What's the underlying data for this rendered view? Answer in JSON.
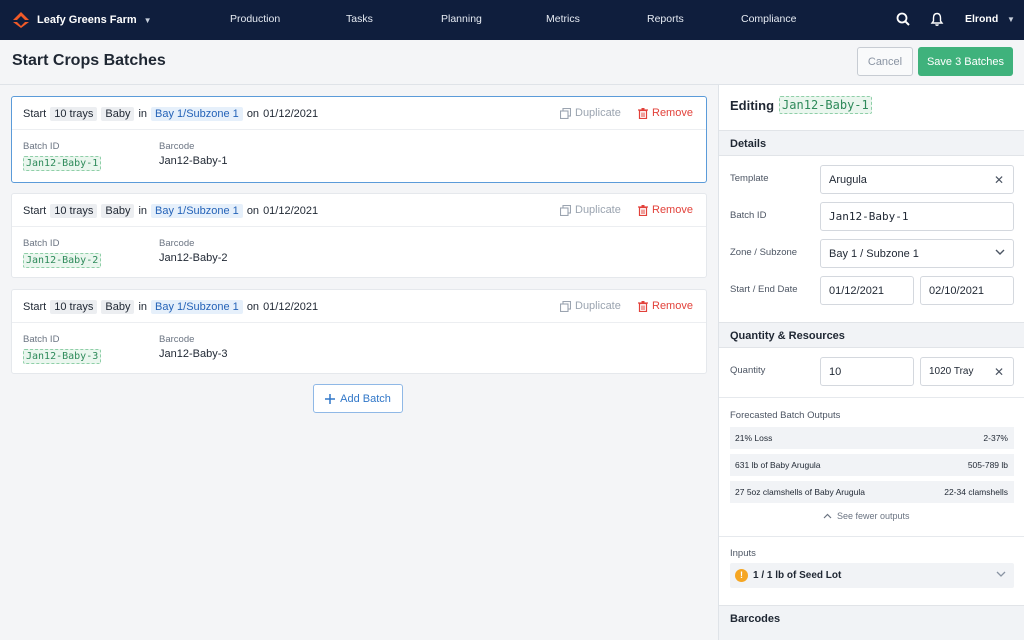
{
  "nav": {
    "brand": "Leafy Greens Farm",
    "items": [
      "Production",
      "Tasks",
      "Planning",
      "Metrics",
      "Reports",
      "Compliance"
    ],
    "user": "Elrond"
  },
  "header": {
    "title": "Start Crops Batches",
    "cancel_label": "Cancel",
    "save_label": "Save 3 Batches"
  },
  "batch_common": {
    "start_word": "Start",
    "qty": "10 trays",
    "crop": "Baby",
    "in_word": "in",
    "location": "Bay 1/Subzone 1",
    "on_word": "on",
    "date": "01/12/2021",
    "duplicate_label": "Duplicate",
    "remove_label": "Remove",
    "batch_id_label": "Batch ID",
    "barcode_label": "Barcode"
  },
  "batches": [
    {
      "batch_id": "Jan12-Baby-1",
      "barcode": "Jan12-Baby-1"
    },
    {
      "batch_id": "Jan12-Baby-2",
      "barcode": "Jan12-Baby-2"
    },
    {
      "batch_id": "Jan12-Baby-3",
      "barcode": "Jan12-Baby-3"
    }
  ],
  "add_batch_label": "Add Batch",
  "panel": {
    "editing_label": "Editing",
    "editing_id": "Jan12-Baby-1",
    "details_title": "Details",
    "template_label": "Template",
    "template_value": "Arugula",
    "batch_id_label": "Batch ID",
    "batch_id_value": "Jan12-Baby-1",
    "zone_label": "Zone / Subzone",
    "zone_value": "Bay 1 / Subzone 1",
    "dates_label": "Start / End Date",
    "start_date": "01/12/2021",
    "end_date": "02/10/2021",
    "qty_title": "Quantity & Resources",
    "quantity_label": "Quantity",
    "quantity_value": "10",
    "unit_value": "1020 Tray",
    "forecast_title": "Forecasted Batch Outputs",
    "forecast": [
      {
        "label": "21% Loss",
        "range": "2-37%"
      },
      {
        "label": "631 lb of Baby Arugula",
        "range": "505-789 lb"
      },
      {
        "label": "27 5oz clamshells of Baby Arugula",
        "range": "22-34 clamshells"
      }
    ],
    "see_fewer": "See fewer outputs",
    "inputs_title": "Inputs",
    "input_item": "1 / 1 lb of Seed Lot",
    "barcodes_title": "Barcodes"
  },
  "colors": {
    "topbar": "#0f1e3d",
    "save_green": "#3fb27c",
    "link_blue": "#3177c8",
    "remove_red": "#e2413a",
    "active_border": "#5b9bd9"
  }
}
